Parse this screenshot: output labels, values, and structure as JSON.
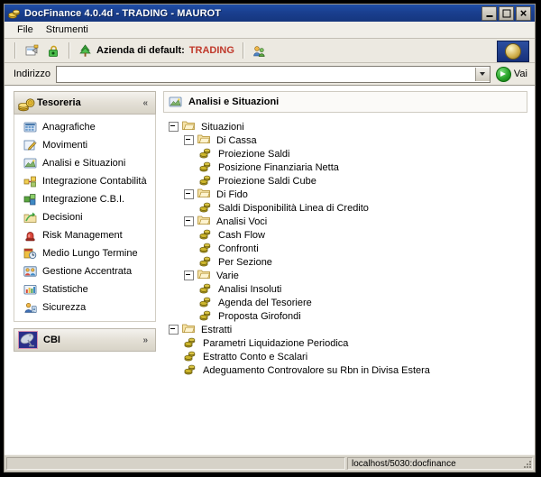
{
  "window": {
    "title": "DocFinance 4.0.4d  - TRADING - MAUROT",
    "icon": "coins-icon",
    "buttons": {
      "minimize": "minimize-button",
      "maximize": "maximize-button",
      "close": "close-button"
    }
  },
  "menubar": {
    "items": [
      {
        "label": "File"
      },
      {
        "label": "Strumenti"
      }
    ]
  },
  "toolbar": {
    "buttons": [
      {
        "name": "new-document-button",
        "icon": "document-new-icon"
      },
      {
        "name": "lock-button",
        "icon": "green-padlock-icon"
      }
    ],
    "default_company_icon": "green-tree-icon",
    "default_company_label": "Azienda di default:",
    "default_company_value": "TRADING",
    "users_button": {
      "name": "users-button",
      "icon": "two-people-icon"
    },
    "logo": "application-logo"
  },
  "address": {
    "label": "Indirizzo",
    "value": "",
    "placeholder": "",
    "go_label": "Vai",
    "dropdown_icon": "chevron-down-icon"
  },
  "sidebar": {
    "panels": [
      {
        "title": "Tesoreria",
        "icon": "coins-stack-icon",
        "expanded": true,
        "chevron": "«",
        "items": [
          {
            "label": "Anagrafiche",
            "icon": "grid-blue-icon",
            "name": "sidebar-item-anagrafiche"
          },
          {
            "label": "Movimenti",
            "icon": "pencil-edit-icon",
            "name": "sidebar-item-movimenti"
          },
          {
            "label": "Analisi e Situazioni",
            "icon": "chart-picture-icon",
            "name": "sidebar-item-analisi-e-situazioni"
          },
          {
            "label": "Integrazione Contabilità",
            "icon": "yellow-blocks-icon",
            "name": "sidebar-item-integrazione-contabilita"
          },
          {
            "label": "Integrazione C.B.I.",
            "icon": "green-blocks-icon",
            "name": "sidebar-item-integrazione-cbi"
          },
          {
            "label": "Decisioni",
            "icon": "green-arrow-folder-icon",
            "name": "sidebar-item-decisioni"
          },
          {
            "label": "Risk Management",
            "icon": "red-siren-icon",
            "name": "sidebar-item-risk-management"
          },
          {
            "label": "Medio Lungo Termine",
            "icon": "clock-calendar-icon",
            "name": "sidebar-item-medio-lungo-termine"
          },
          {
            "label": "Gestione Accentrata",
            "icon": "people-blue-icon",
            "name": "sidebar-item-gestione-accentrata"
          },
          {
            "label": "Statistiche",
            "icon": "bar-chart-icon",
            "name": "sidebar-item-statistiche"
          },
          {
            "label": "Sicurezza",
            "icon": "security-user-icon",
            "name": "sidebar-item-sicurezza"
          }
        ]
      },
      {
        "title": "CBI",
        "icon": "satellite-dish-icon",
        "expanded": false,
        "chevron": "»",
        "items": []
      }
    ]
  },
  "main": {
    "header": {
      "title": "Analisi e Situazioni",
      "icon": "chart-picture-icon"
    },
    "tree": [
      {
        "level": 0,
        "type": "folder",
        "expanded": true,
        "label": "Situazioni"
      },
      {
        "level": 1,
        "type": "folder",
        "expanded": true,
        "label": "Di Cassa"
      },
      {
        "level": 2,
        "type": "leaf",
        "label": "Proiezione Saldi"
      },
      {
        "level": 2,
        "type": "leaf",
        "label": "Posizione Finanziaria Netta"
      },
      {
        "level": 2,
        "type": "leaf",
        "label": "Proiezione Saldi Cube"
      },
      {
        "level": 1,
        "type": "folder",
        "expanded": true,
        "label": "Di Fido"
      },
      {
        "level": 2,
        "type": "leaf",
        "label": "Saldi Disponibilità Linea di Credito"
      },
      {
        "level": 1,
        "type": "folder",
        "expanded": true,
        "label": "Analisi Voci"
      },
      {
        "level": 2,
        "type": "leaf",
        "label": "Cash Flow"
      },
      {
        "level": 2,
        "type": "leaf",
        "label": "Confronti"
      },
      {
        "level": 2,
        "type": "leaf",
        "label": "Per Sezione"
      },
      {
        "level": 1,
        "type": "folder",
        "expanded": true,
        "label": "Varie"
      },
      {
        "level": 2,
        "type": "leaf",
        "label": "Analisi Insoluti"
      },
      {
        "level": 2,
        "type": "leaf",
        "label": "Agenda del Tesoriere"
      },
      {
        "level": 2,
        "type": "leaf",
        "label": "Proposta Girofondi"
      },
      {
        "level": 0,
        "type": "folder",
        "expanded": true,
        "label": "Estratti"
      },
      {
        "level": 1,
        "type": "leaf",
        "label": "Parametri Liquidazione Periodica"
      },
      {
        "level": 1,
        "type": "leaf",
        "label": "Estratto Conto e Scalari"
      },
      {
        "level": 1,
        "type": "leaf",
        "label": "Adeguamento Controvalore su Rbn in Divisa Estera"
      }
    ]
  },
  "statusbar": {
    "left": "",
    "right": "localhost/5030:docfinance"
  },
  "colors": {
    "titlebar": "#1a3f8f",
    "company_accent": "#c0392b",
    "panel_header": "#e4e0d6",
    "window_bg": "#d6d2c8"
  }
}
